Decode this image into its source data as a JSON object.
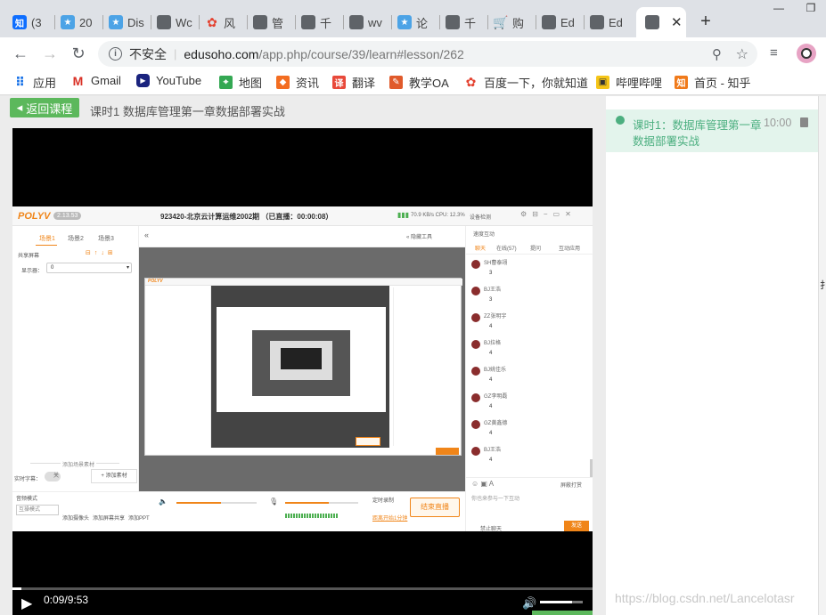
{
  "browser": {
    "tabs": [
      {
        "label": "(3",
        "icon": "zhihu-icon"
      },
      {
        "label": "20",
        "icon": "trophy-icon"
      },
      {
        "label": "Dis",
        "icon": "trophy-icon"
      },
      {
        "label": "Wc",
        "icon": "globe-icon"
      },
      {
        "label": "风",
        "icon": "paw-icon"
      },
      {
        "label": "管",
        "icon": "globe-icon"
      },
      {
        "label": "千",
        "icon": "globe-icon"
      },
      {
        "label": "wv",
        "icon": "globe-icon"
      },
      {
        "label": "论",
        "icon": "trophy-icon"
      },
      {
        "label": "千",
        "icon": "globe-icon"
      },
      {
        "label": "购",
        "icon": "cart-icon"
      },
      {
        "label": "Ed",
        "icon": "globe-icon"
      },
      {
        "label": "Ed",
        "icon": "globe-icon"
      },
      {
        "label": "",
        "icon": "globe-icon",
        "active": true
      }
    ],
    "security_label": "不安全",
    "url_host": "edusoho.com",
    "url_path": "/app.php/course/39/learn#lesson/262",
    "bookmarks": [
      {
        "label": "应用",
        "icon": "apps-icon"
      },
      {
        "label": "Gmail",
        "icon": "gmail-icon"
      },
      {
        "label": "YouTube",
        "icon": "youtube-icon"
      },
      {
        "label": "地图",
        "icon": "maps-icon"
      },
      {
        "label": "资讯",
        "icon": "news-icon"
      },
      {
        "label": "翻译",
        "icon": "translate-icon"
      },
      {
        "label": "教学OA",
        "icon": "oa-icon"
      },
      {
        "label": "百度一下，你就知道",
        "icon": "baidu-icon"
      },
      {
        "label": "哔哩哔哩",
        "icon": "bilibili-icon"
      },
      {
        "label": "首页 - 知乎",
        "icon": "zhihu-icon"
      }
    ]
  },
  "page": {
    "back_button": "返回课程",
    "lesson_title": "课时1  数据库管理第一章数据部署实战"
  },
  "sidebar": {
    "lesson_item": {
      "title_line1": "课时1：数据库管理第一章",
      "title_line2": "数据部署实战",
      "duration": "10:00"
    }
  },
  "video": {
    "current_time": "0:09",
    "total_time": "9:53",
    "time_separator": "/",
    "progress": 0.015,
    "volume": 0.75
  },
  "inner": {
    "brand": "POLYV",
    "version": "2.13.53",
    "title": "923420-北京云计算运维2002期 （已直播：00:00:08）",
    "net": "70.9 KB/s  CPU: 12.3%",
    "device_test": "设备检测",
    "scene_tabs": [
      "场景1",
      "场景2",
      "场景3"
    ],
    "share_screen": "共享屏幕",
    "display_label": "显示器：",
    "display_value": "0",
    "add_material_divider": "添加场景素材",
    "live_subtitle": "实时字幕：",
    "subtitle_toggle": "关",
    "add_material": "+ 添加素材",
    "collapse_left": "«",
    "hide_tools": "« 隐藏工具",
    "interact_select": "速度互动",
    "chat_tabs": [
      "聊天",
      "在线(57)",
      "提问",
      "互动应用"
    ],
    "chat": [
      {
        "name": "SH曹泰翊",
        "msg": "3"
      },
      {
        "name": "BJ王浩",
        "msg": "3"
      },
      {
        "name": "ZZ张明宇",
        "msg": "4"
      },
      {
        "name": "BJ拉格",
        "msg": "4"
      },
      {
        "name": "BJ姚佳乐",
        "msg": "4"
      },
      {
        "name": "GZ李明磊",
        "msg": "4"
      },
      {
        "name": "GZ黄鑫德",
        "msg": "4"
      },
      {
        "name": "BJ王浩",
        "msg": "4"
      }
    ],
    "block_chat": "屏蔽打赏",
    "chat_placeholder": "你也来参与一下互动",
    "forbid_chat": "禁止聊天",
    "send": "发送",
    "audio_label": "音频模式",
    "mode_select": "互操模式",
    "tools": [
      "添加摄像头",
      "添加屏幕共享",
      "添加PPT"
    ],
    "timed_record": "定时录制",
    "time_counter": "距离开始1分钟",
    "end_live": "结束直播"
  },
  "watermark": "https://blog.csdn.net/Lancelotasr",
  "colors": {
    "accent_green": "#5cb85c",
    "polyv_orange": "#f08519",
    "sidebar_highlight": "#e3f4ec",
    "sidebar_green": "#4caf80"
  }
}
